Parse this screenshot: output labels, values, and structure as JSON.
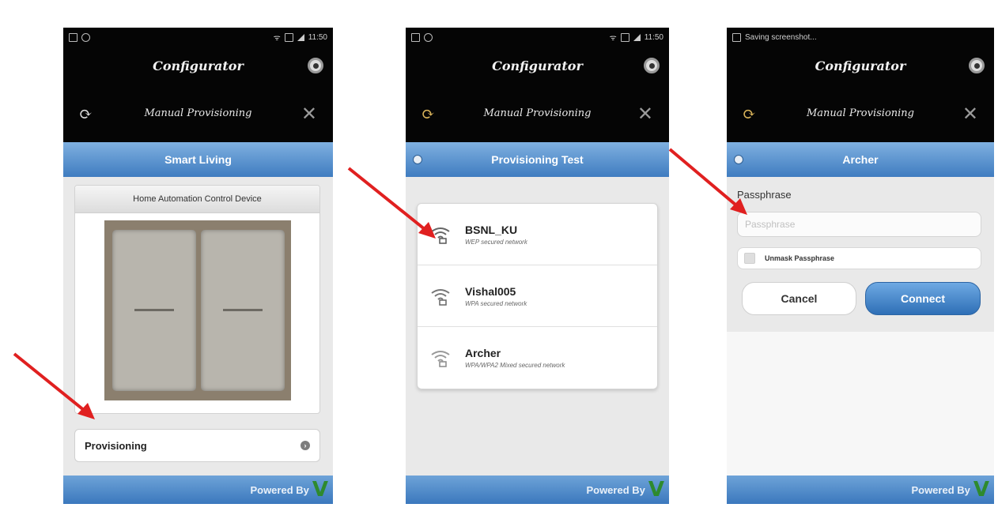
{
  "screens": [
    {
      "status": {
        "left": "",
        "right": "11:50"
      },
      "app_title": "Configurator",
      "toolbar_title": "Manual Provisioning",
      "header": "Smart Living",
      "card_title": "Home Automation Control Device",
      "provisioning_label": "Provisioning",
      "footer": {
        "text": "Powered By"
      }
    },
    {
      "status": {
        "left": "",
        "right": "11:50"
      },
      "app_title": "Configurator",
      "toolbar_title": "Manual Provisioning",
      "header": "Provisioning Test",
      "networks": [
        {
          "name": "BSNL_KU",
          "security": "WEP secured network"
        },
        {
          "name": "Vishal005",
          "security": "WPA secured network"
        },
        {
          "name": "Archer",
          "security": "WPA/WPA2 Mixed secured network"
        }
      ],
      "footer": {
        "text": "Powered By"
      }
    },
    {
      "status": {
        "left": "Saving screenshot...",
        "right": ""
      },
      "app_title": "Configurator",
      "toolbar_title": "Manual Provisioning",
      "header": "Archer",
      "passphrase_label": "Passphrase",
      "passphrase_placeholder": "Passphrase",
      "unmask_label": "Unmask Passphrase",
      "cancel_label": "Cancel",
      "connect_label": "Connect",
      "footer": {
        "text": "Powered By"
      }
    }
  ],
  "colors": {
    "header_blue": "#4a86c8",
    "arrow_red": "#e02020",
    "titlebar_black": "#050505"
  }
}
